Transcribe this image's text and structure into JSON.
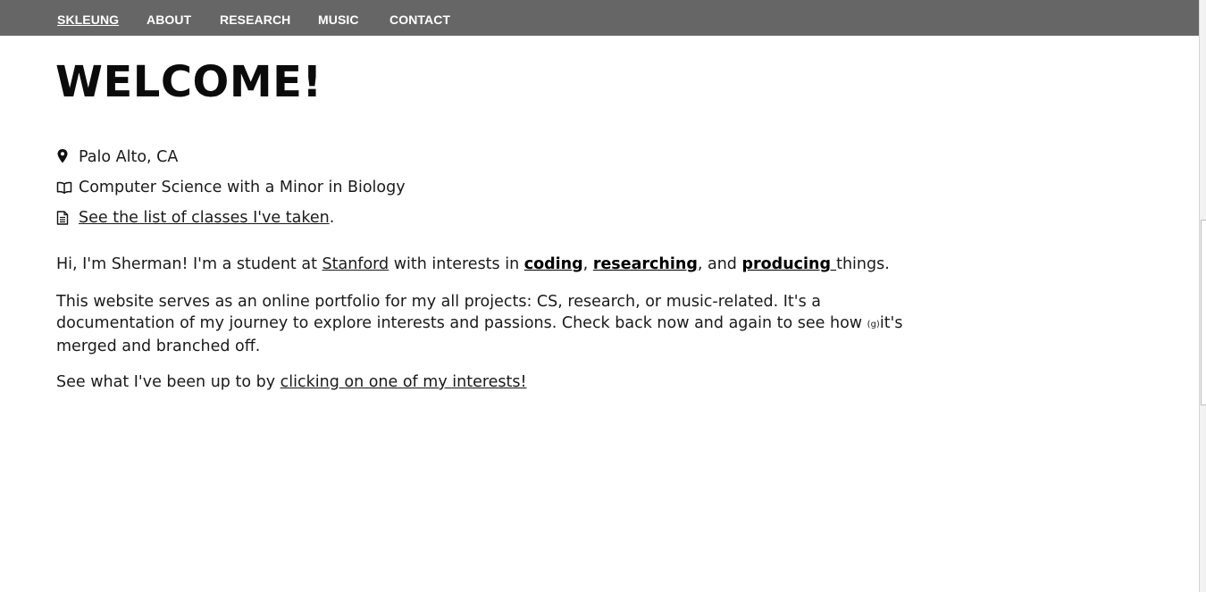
{
  "nav": {
    "items": [
      {
        "label": "SKLEUNG",
        "active": true
      },
      {
        "label": "ABOUT"
      },
      {
        "label": "RESEARCH"
      },
      {
        "label": "MUSIC"
      },
      {
        "label": "CONTACT"
      }
    ]
  },
  "main": {
    "title": "WELCOME!",
    "info": {
      "location": {
        "icon": "map-marker-icon",
        "text": "Palo Alto, CA"
      },
      "study": {
        "icon": "open-book-icon",
        "text": "Computer Science with a Minor in Biology"
      },
      "classes": {
        "icon": "document-icon",
        "link": "See the list of classes I've taken",
        "suffix": "."
      }
    },
    "intro": {
      "t1": "Hi, I'm Sherman! I'm a student at ",
      "stanford": "Stanford",
      "t2": " with interests in ",
      "coding": "coding",
      "t3": ", ",
      "researching": "researching",
      "t4": ", and ",
      "producing": "producing ",
      "t5": "things."
    },
    "portfolio": {
      "t1": "This website serves as an online portfolio for my all projects: CS, research, or music-related. It's a documentation of my journey to explore interests and passions. Check back now and again to see how ",
      "small": "(g)",
      "t2": "it's merged and branched off."
    },
    "cta": {
      "t1": "See what I've been up to by ",
      "link": "clicking on one of my interests!"
    }
  },
  "colors": {
    "navbar": "#666666",
    "nav_text": "#ffffff",
    "text": "#1a1a1a"
  }
}
